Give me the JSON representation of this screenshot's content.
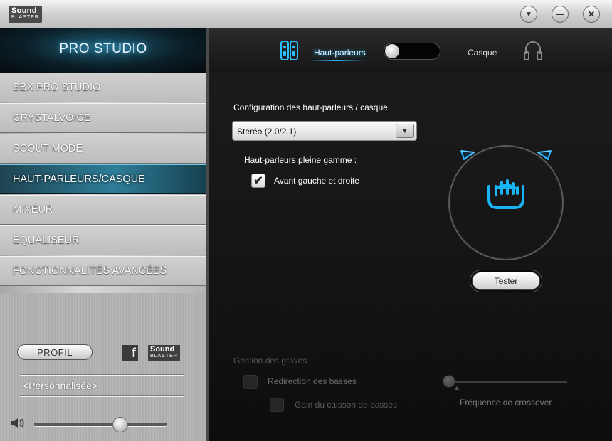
{
  "titlebar": {
    "logo_line1": "Sound",
    "logo_line2": "BLASTER",
    "buttons": [
      {
        "icon": "chevron-down-icon",
        "glyph": "▼"
      },
      {
        "icon": "minimize-icon",
        "glyph": "—"
      },
      {
        "icon": "close-icon",
        "glyph": "✕"
      }
    ]
  },
  "sidebar": {
    "brand": "PRO STUDIO",
    "items": [
      {
        "label": "SBX PRO STUDIO",
        "active": false
      },
      {
        "label": "CRYSTALVOICE",
        "active": false
      },
      {
        "label": "SCOUT MODE",
        "active": false
      },
      {
        "label": "HAUT-PARLEURS/CASQUE",
        "active": true
      },
      {
        "label": "MIXEUR",
        "active": false
      },
      {
        "label": "EQUALISEUR",
        "active": false
      },
      {
        "label": "FONCTIONNALITÉS AVANCÉES",
        "active": false
      }
    ],
    "profil_label": "PROFIL",
    "facebook_glyph": "f",
    "sb_logo_line1": "Sound",
    "sb_logo_line2": "BLASTER",
    "preset": "<Personnalisée>",
    "volume_level": 0.66
  },
  "main": {
    "speakers_label": "Haut-parleurs",
    "headphones_label": "Casque",
    "output_toggle": "Haut-parleurs",
    "config_label": "Configuration des haut-parleurs / casque",
    "config_value": "Stéréo (2.0/2.1)",
    "full_range_label": "Haut-parleurs pleine gamme :",
    "front_lr_checked": true,
    "front_lr_label": "Avant gauche et droite",
    "test_button": "Tester",
    "bass_section_title": "Gestion des graves",
    "bass_redirect_label": "Redirection des basses",
    "sub_gain_label": "Gain du caisson de basses",
    "crossover_label": "Fréquence de crossover",
    "crossover_level": 0,
    "accent_color": "#19b4f5"
  }
}
